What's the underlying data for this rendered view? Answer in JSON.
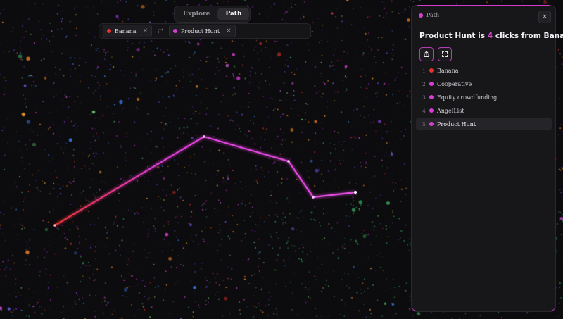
{
  "mode_toggle": {
    "tabs": [
      {
        "label": "Explore",
        "active": false
      },
      {
        "label": "Path",
        "active": true
      }
    ]
  },
  "endpoints": {
    "from": {
      "label": "Banana",
      "color": "#e8322e"
    },
    "to": {
      "label": "Product Hunt",
      "color": "#d63fd6"
    },
    "remove_glyph": "×",
    "swap_glyph": "⇄"
  },
  "panel": {
    "title": "Path",
    "close_glyph": "×",
    "headline": {
      "target": "Product Hunt",
      "pre": " is ",
      "count": "4",
      "post": " clicks from ",
      "source": "Banana"
    },
    "actions": [
      {
        "name": "share-icon"
      },
      {
        "name": "fit-view-icon"
      }
    ],
    "path": [
      {
        "index": "1",
        "label": "Banana",
        "color": "#e8322e"
      },
      {
        "index": "2",
        "label": "Cooperative",
        "color": "#d63fd6"
      },
      {
        "index": "3",
        "label": "Equity crowdfunding",
        "color": "#d63fd6"
      },
      {
        "index": "4",
        "label": "AngelList",
        "color": "#d63fd6"
      },
      {
        "index": "5",
        "label": "Product Hunt",
        "color": "#d63fd6",
        "selected": true
      }
    ]
  },
  "colors": {
    "accent": "#d63fd6",
    "start": "#e8322e"
  }
}
